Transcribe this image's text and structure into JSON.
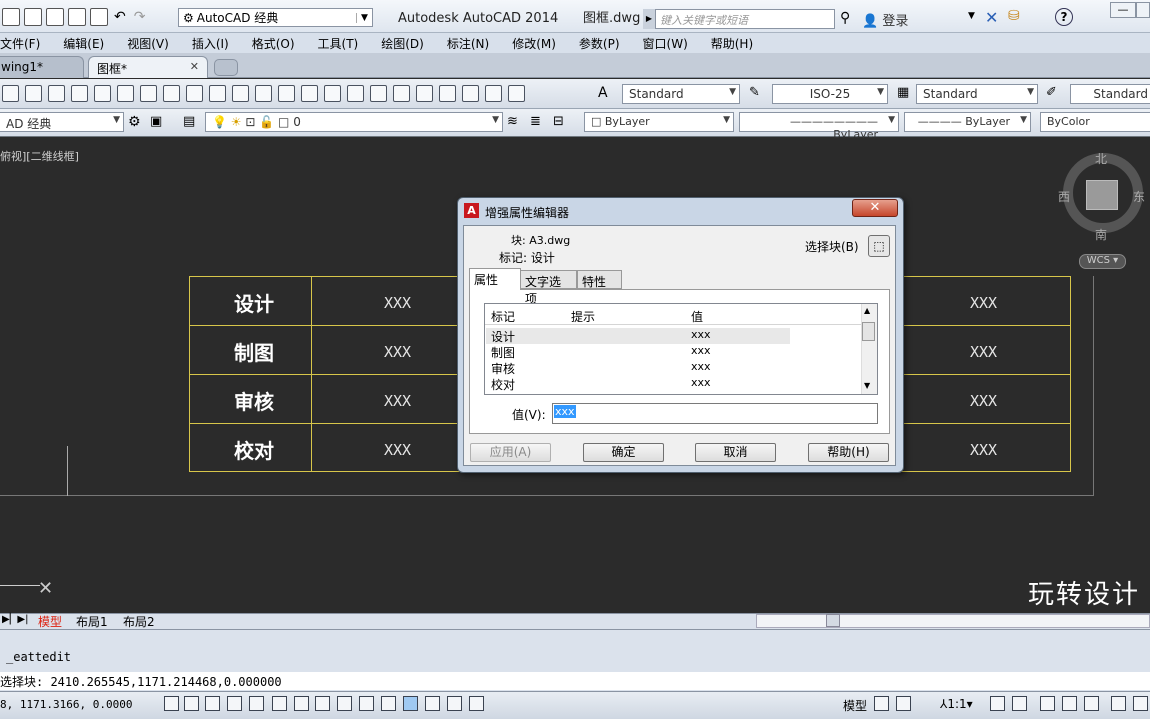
{
  "titlebar": {
    "workspace": "AutoCAD 经典",
    "app_title": "Autodesk AutoCAD 2014",
    "file_name": "图框.dwg",
    "search_placeholder": "键入关键字或短语",
    "login": "登录"
  },
  "menu": [
    "文件(F)",
    "编辑(E)",
    "视图(V)",
    "插入(I)",
    "格式(O)",
    "工具(T)",
    "绘图(D)",
    "标注(N)",
    "修改(M)",
    "参数(P)",
    "窗口(W)",
    "帮助(H)"
  ],
  "doc_tabs": [
    {
      "label": "wing1*"
    },
    {
      "label": "图框*"
    }
  ],
  "toolbar": {
    "text_style": "Standard",
    "dim_style": "ISO-25",
    "table_style": "Standard",
    "mleader_style": "Standard",
    "workspace2": "AD 经典",
    "layer": "0",
    "color": "ByLayer",
    "linetype": "ByLayer",
    "lineweight": "ByLayer",
    "plotstyle": "ByColor"
  },
  "drawing": {
    "view_label": "俯视][二维线框]",
    "compass": {
      "north": "北",
      "south": "南",
      "east": "东",
      "west": "西",
      "wcs": "WCS"
    },
    "rows": [
      {
        "label": "设计",
        "value_left": "XXX",
        "value_right": "XXX"
      },
      {
        "label": "制图",
        "value_left": "XXX",
        "value_right": "XXX"
      },
      {
        "label": "审核",
        "value_left": "XXX",
        "value_right": "XXX"
      },
      {
        "label": "校对",
        "value_left": "XXX",
        "value_right": "XXX"
      }
    ],
    "watermark": "玩转设计"
  },
  "layout_tabs": {
    "model": "模型",
    "layout1": "布局1",
    "layout2": "布局2"
  },
  "command": {
    "line1": "_eattedit",
    "line2": "选择块: 2410.265545,1171.214468,0.000000"
  },
  "status": {
    "coords": "8, 1171.3166, 0.0000",
    "model": "模型",
    "scale": "1:1"
  },
  "dialog": {
    "title": "增强属性编辑器",
    "block_label": "块: A3.dwg",
    "tag_label": "标记: 设计",
    "select_block": "选择块(B)",
    "tabs": [
      "属性",
      "文字选项",
      "特性"
    ],
    "columns": [
      "标记",
      "提示",
      "值"
    ],
    "rows": [
      {
        "tag": "设计",
        "prompt": "",
        "value": "xxx"
      },
      {
        "tag": "制图",
        "prompt": "",
        "value": "xxx"
      },
      {
        "tag": "审核",
        "prompt": "",
        "value": "xxx"
      },
      {
        "tag": "校对",
        "prompt": "",
        "value": "xxx"
      }
    ],
    "value_label": "值(V):",
    "value_current": "xxx",
    "buttons": {
      "apply": "应用(A)",
      "ok": "确定",
      "cancel": "取消",
      "help": "帮助(H)"
    }
  }
}
